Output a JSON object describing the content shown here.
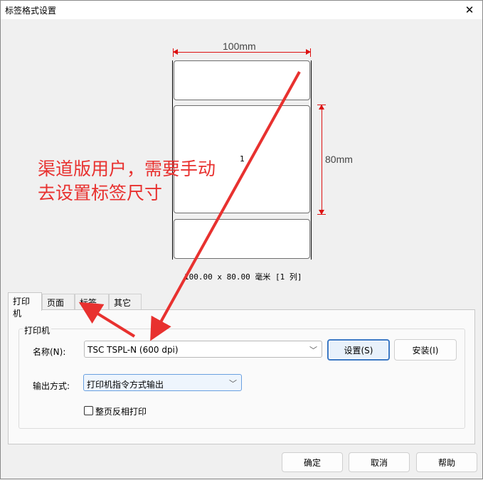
{
  "window": {
    "title": "标签格式设置",
    "close_glyph": "✕"
  },
  "preview": {
    "width_label": "100mm",
    "height_label": "80mm",
    "label_number": "1",
    "size_info": "100.00 x 80.00 毫米 [1 列]",
    "annotation_line1": "渠道版用户，需要手动",
    "annotation_line2": "去设置标签尺寸",
    "annotation_color": "#e8312f"
  },
  "tabs": [
    {
      "label": "打印机",
      "active": true
    },
    {
      "label": "页面",
      "active": false
    },
    {
      "label": "标签",
      "active": false
    },
    {
      "label": "其它",
      "active": false
    }
  ],
  "printer_group": {
    "title": "打印机",
    "name_label": "名称(N):",
    "name_value": "TSC TSPL-N (600 dpi)",
    "setup_button": "设置(S)",
    "install_button": "安装(I)",
    "output_label": "输出方式:",
    "output_value": "打印机指令方式输出",
    "reverse_checkbox": "整页反相打印",
    "reverse_checked": false
  },
  "footer": {
    "ok": "确定",
    "cancel": "取消",
    "help": "帮助"
  }
}
